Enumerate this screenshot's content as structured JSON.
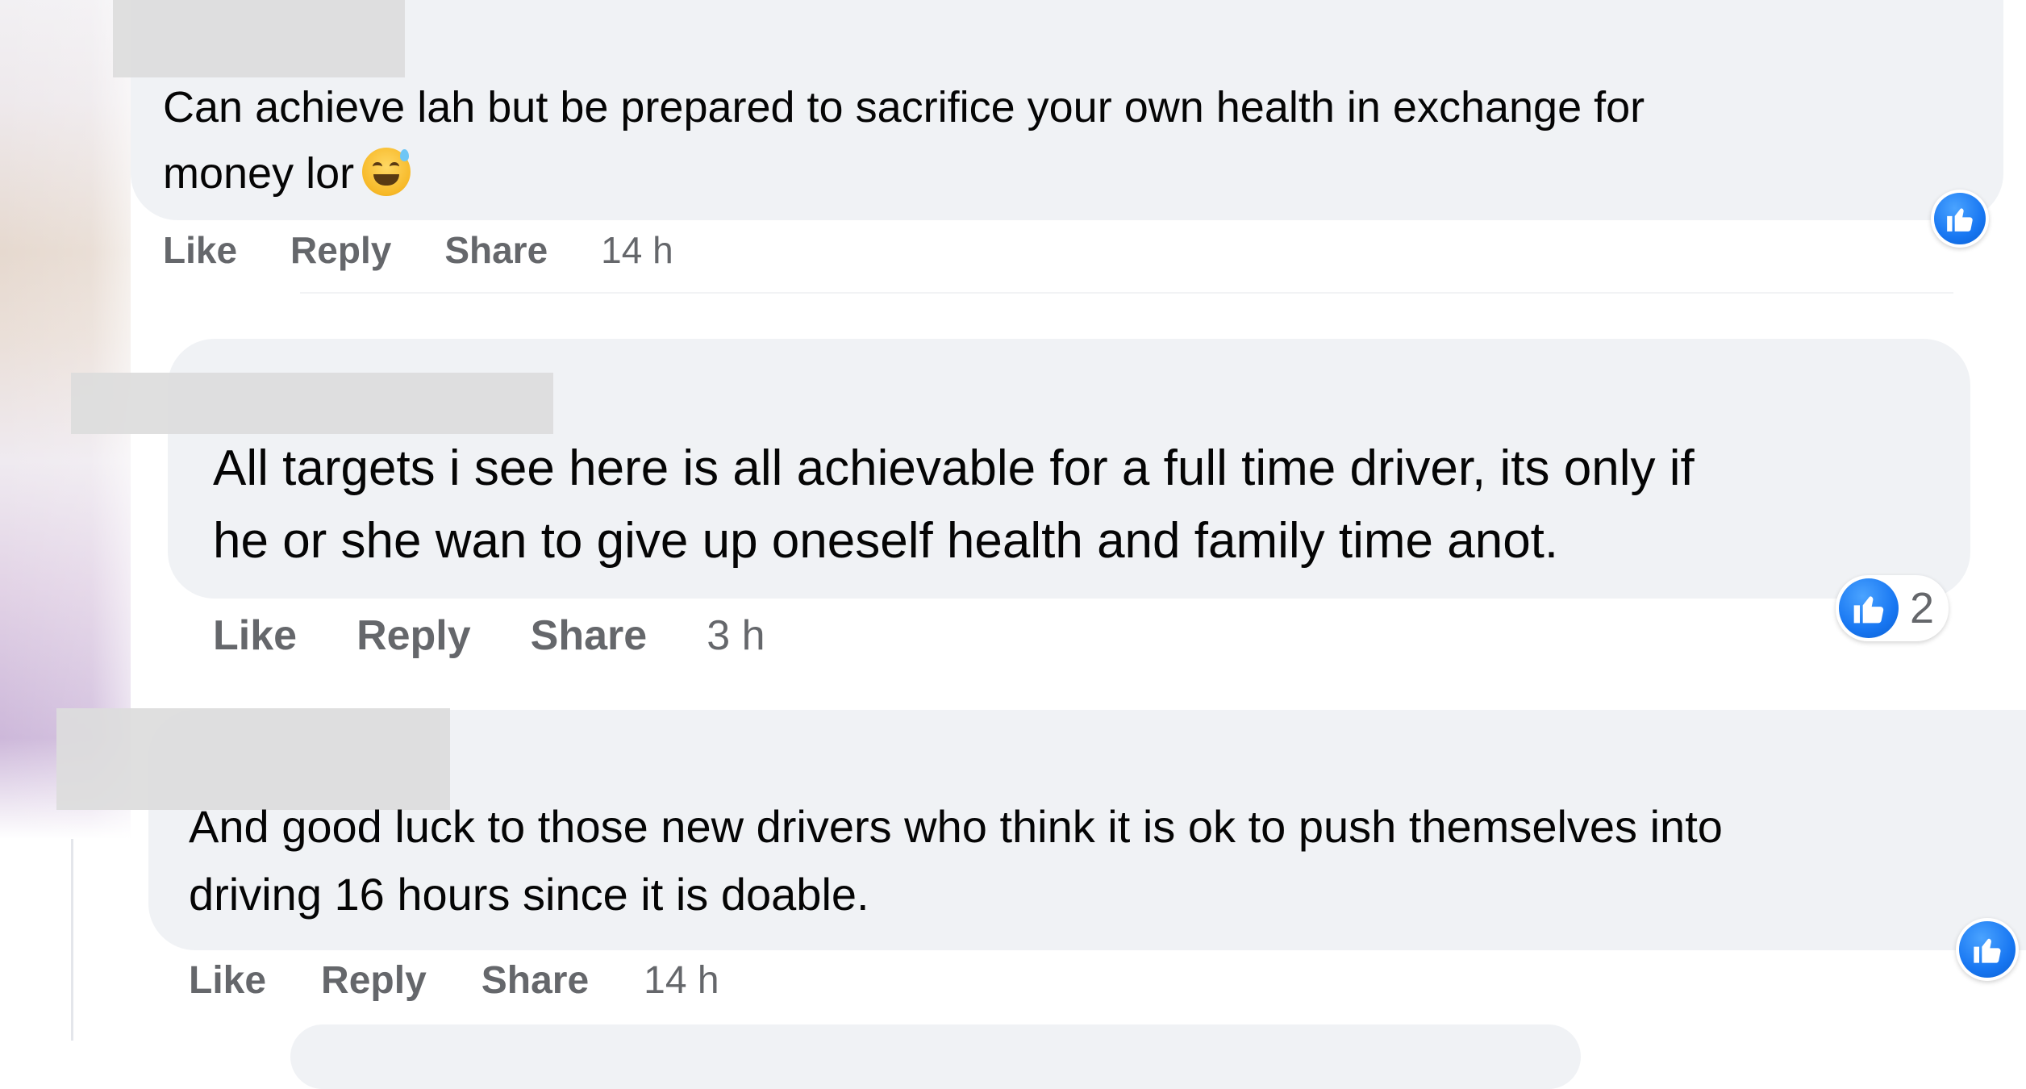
{
  "comments": [
    {
      "text_line1": "Can achieve lah but be prepared to sacrifice your own health in exchange for",
      "text_line2": "money lor",
      "emoji": "grinning-face-with-sweat",
      "actions": {
        "like": "Like",
        "reply": "Reply",
        "share": "Share"
      },
      "timestamp": "14 h",
      "reaction": {
        "type": "like",
        "count": ""
      }
    },
    {
      "text_line1": "All targets i see here is all achievable for a full time driver, its only if",
      "text_line2": "he or she wan to give up oneself health and family time anot.",
      "actions": {
        "like": "Like",
        "reply": "Reply",
        "share": "Share"
      },
      "timestamp": "3 h",
      "reaction": {
        "type": "like",
        "count": "2"
      }
    },
    {
      "text_line1": "And good luck to those new drivers who think it is ok to push themselves into",
      "text_line2": "driving 16 hours since it is doable.",
      "actions": {
        "like": "Like",
        "reply": "Reply",
        "share": "Share"
      },
      "timestamp": "14 h",
      "reaction": {
        "type": "like",
        "count": ""
      }
    }
  ],
  "colors": {
    "bubble": "#f0f2f5",
    "text": "#050505",
    "secondary_text": "#65676b",
    "like_blue": "#1877f2"
  }
}
